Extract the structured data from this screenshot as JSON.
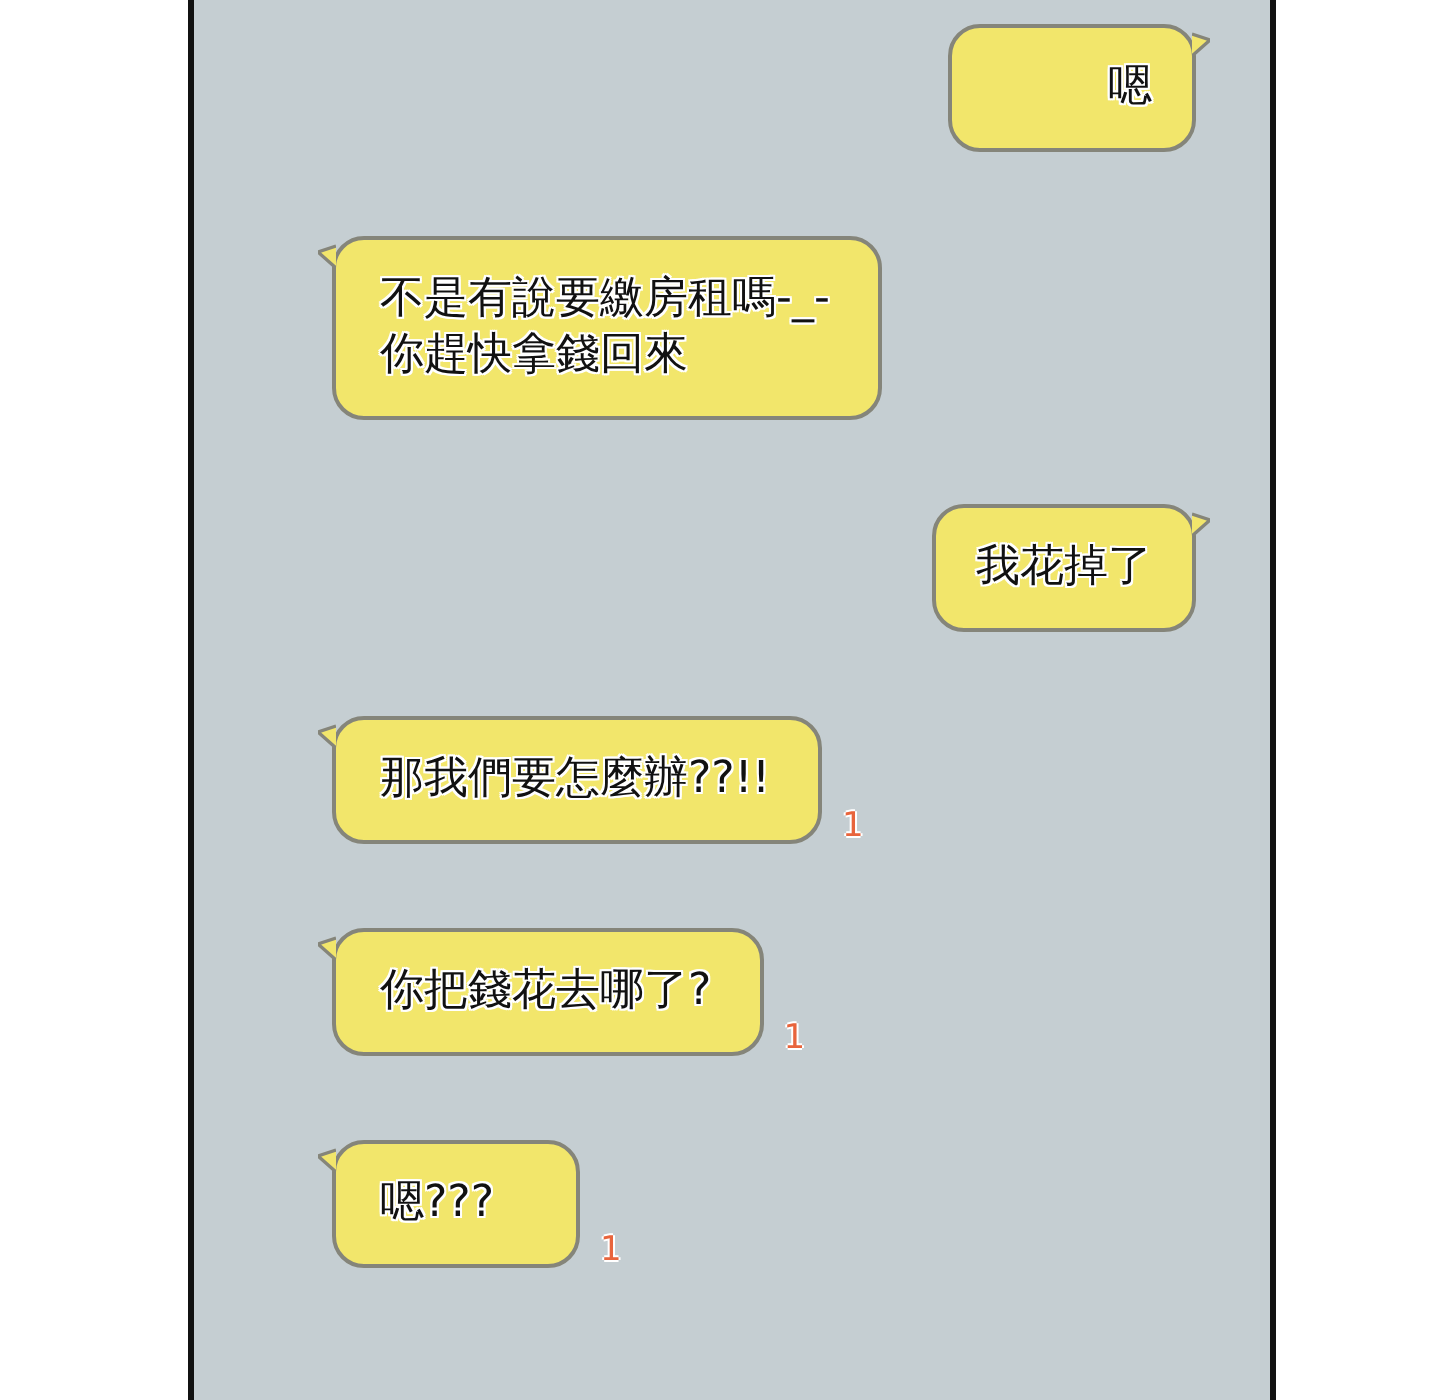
{
  "panel": {
    "messages": [
      {
        "kind": "sent",
        "text": "嗯"
      },
      {
        "kind": "received",
        "text": "不是有說要繳房租嗎-_-\n你趕快拿錢回來"
      },
      {
        "kind": "sent",
        "text": "我花掉了"
      },
      {
        "kind": "received",
        "text": "那我們要怎麼辦??!!",
        "unread": "1"
      },
      {
        "kind": "received",
        "text": "你把錢花去哪了?",
        "unread": "1"
      },
      {
        "kind": "received",
        "text": "嗯???",
        "unread": "1"
      }
    ]
  }
}
